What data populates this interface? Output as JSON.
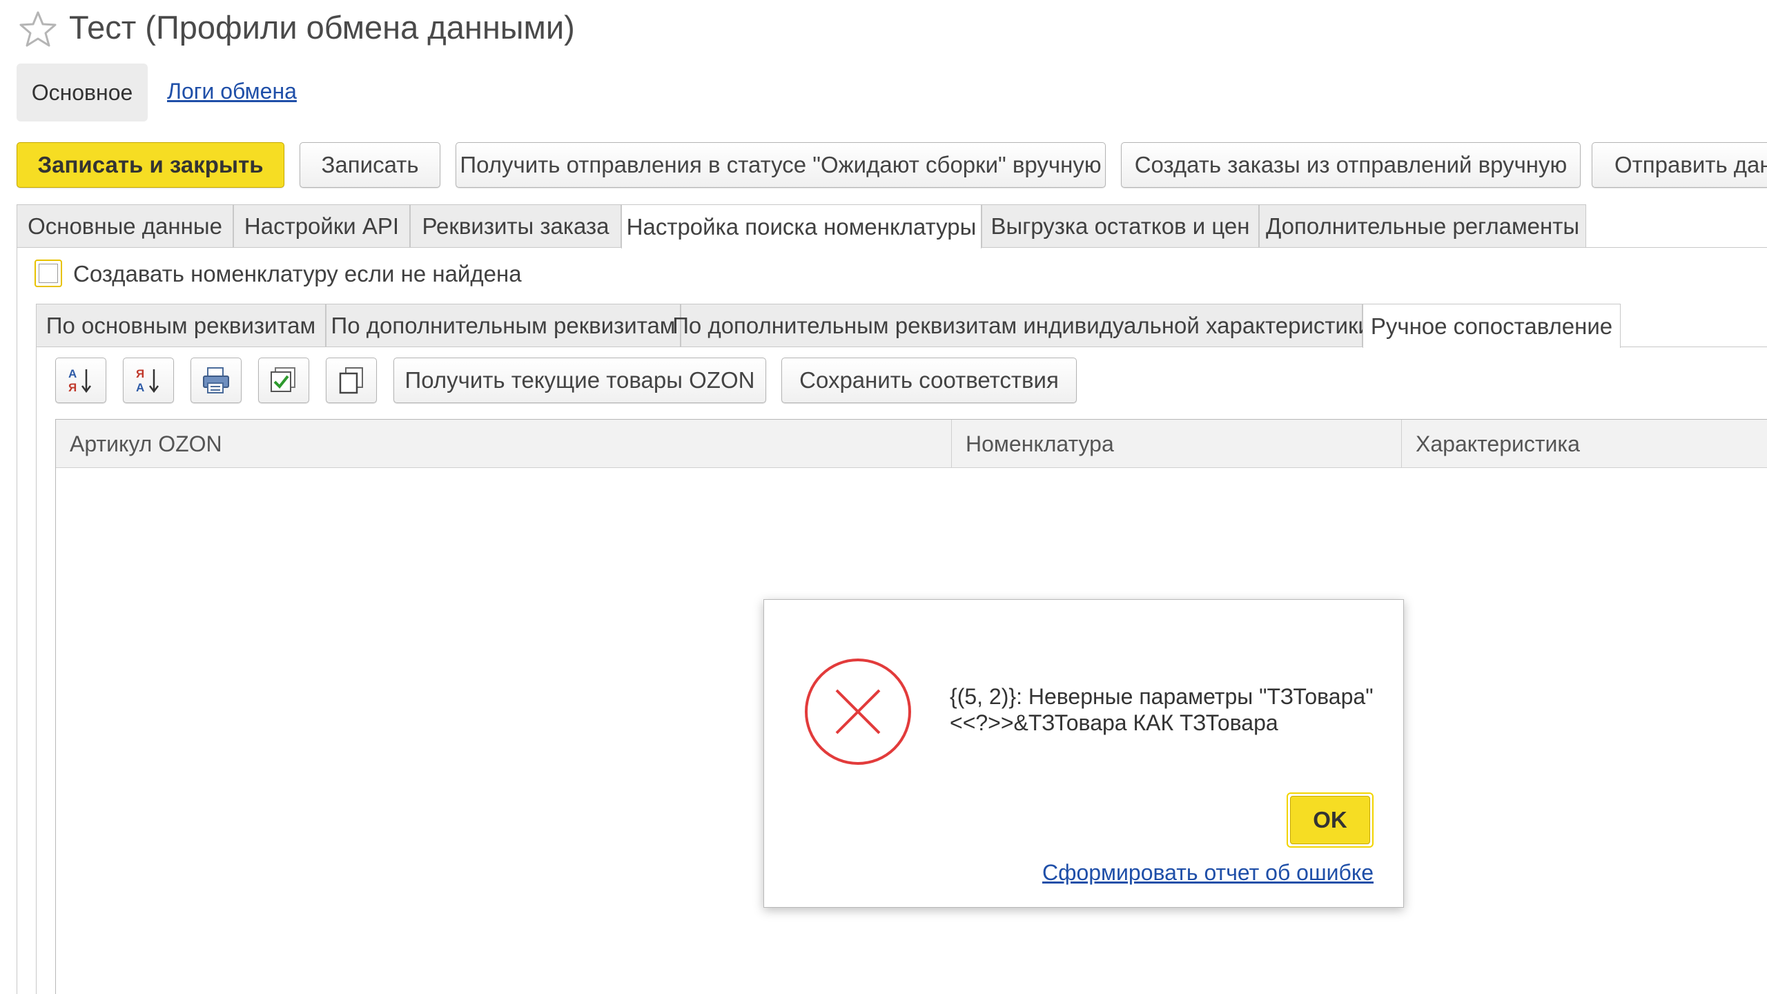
{
  "window": {
    "title": "Тест (Профили обмена данными)",
    "star_icon": "star-outline-icon"
  },
  "nav": {
    "main": "Основное",
    "logs": "Логи обмена"
  },
  "toolbar": {
    "save_close": "Записать и закрыть",
    "save": "Записать",
    "get_shipments": "Получить отправления в статусе \"Ожидают сборки\" вручную",
    "create_orders": "Создать заказы из отправлений вручную",
    "send": "Отправить данн"
  },
  "tabs": [
    {
      "label": "Основные данные",
      "active": false
    },
    {
      "label": "Настройки API",
      "active": false
    },
    {
      "label": "Реквизиты заказа",
      "active": false
    },
    {
      "label": "Настройка поиска номенклатуры",
      "active": true
    },
    {
      "label": "Выгрузка остатков и цен",
      "active": false
    },
    {
      "label": "Дополнительные регламенты",
      "active": false
    }
  ],
  "create_item_checkbox": {
    "label": "Создавать номенклатуру если не найдена",
    "checked": false
  },
  "subtabs": [
    {
      "label": "По основным реквизитам",
      "active": false
    },
    {
      "label": "По дополнительным реквизитам",
      "active": false
    },
    {
      "label": "По дополнительным реквизитам индивидуальной характеристики",
      "active": false
    },
    {
      "label": "Ручное сопоставление",
      "active": true
    }
  ],
  "grid_toolbar": {
    "icons": [
      "sort-ascending-icon",
      "sort-descending-icon",
      "print-icon",
      "check-all-icon",
      "copy-icon"
    ],
    "get_products": "Получить текущие товары OZON",
    "save_mapping": "Сохранить соответствия"
  },
  "grid": {
    "columns": [
      "Артикул OZON",
      "Номенклатура",
      "Характеристика"
    ],
    "rows": []
  },
  "dialog": {
    "icon": "error-x-icon",
    "message_line1": "{(5, 2)}: Неверные параметры \"ТЗТовара\"",
    "message_line2": "<<?>>&ТЗТовара КАК ТЗТовара",
    "ok": "OK",
    "report_link": "Сформировать отчет об ошибке"
  },
  "colors": {
    "accent_yellow": "#f6dd23",
    "link_blue": "#1f4fa8",
    "error_red": "#e23b3b"
  }
}
